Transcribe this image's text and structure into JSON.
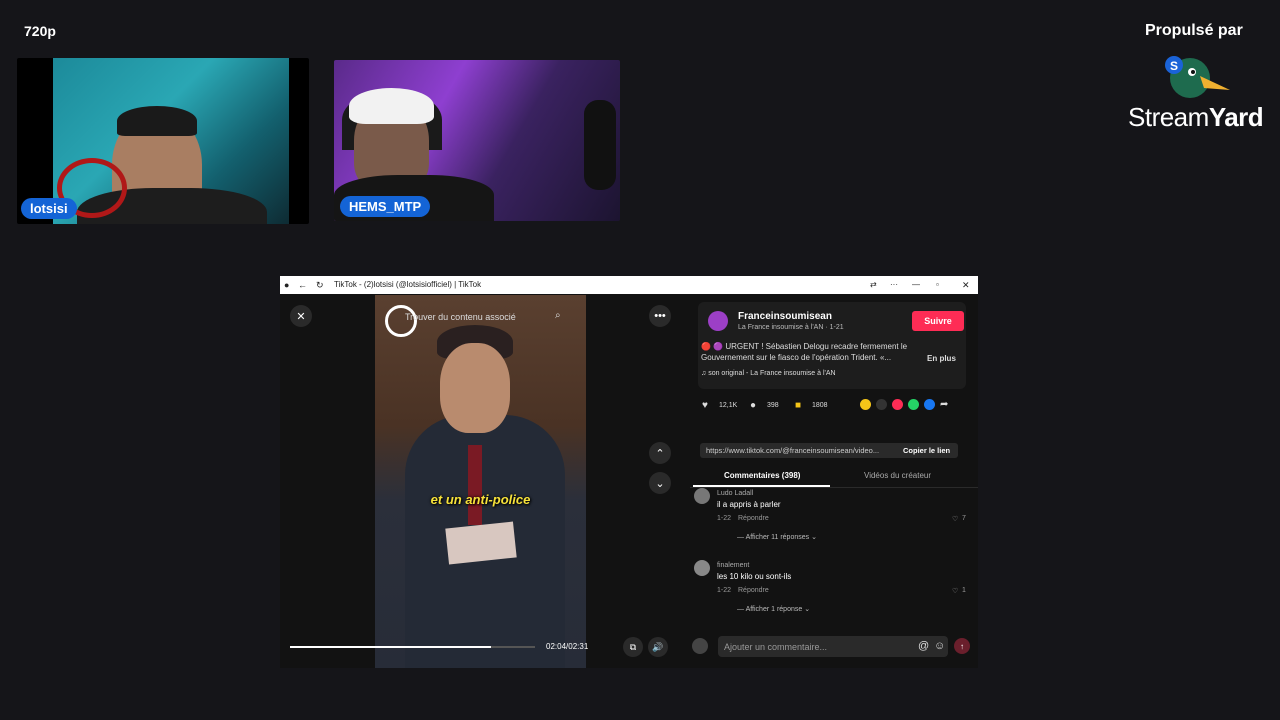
{
  "stream": {
    "quality": "720p",
    "brand_top": "Propulsé par",
    "brand_name_a": "Stream",
    "brand_name_b": "Yard",
    "participants": [
      "lotsisi",
      "HEMS_MTP"
    ]
  },
  "browser": {
    "title": "TikTok - (2)lotsisi (@lotsisiofficiel) | TikTok"
  },
  "video": {
    "overlay_text": "Trouver du contenu associé",
    "subtitle": "et un anti-police",
    "time": "02:04/02:31",
    "progress": 0.82
  },
  "panel": {
    "author": "Franceinsoumisean",
    "author_sub": "La France insoumise à l'AN · 1-21",
    "follow": "Suivre",
    "caption": "🔴 🟣 URGENT ! Sébastien Delogu recadre fermement le Gouvernement sur le fiasco de l'opération Trident. «...",
    "more": "En plus",
    "sound": "♫ son original - La France insoumise à l'AN",
    "likes": "12,1K",
    "comments": "398",
    "saves": "1808",
    "link": "https://www.tiktok.com/@franceinsoumisean/video...",
    "copy_link": "Copier le lien",
    "tab_comments": "Commentaires (398)",
    "tab_videos": "Vidéos du créateur",
    "comment_list": [
      {
        "name": "Ludo Ladall",
        "text": "il a appris à parler",
        "date": "1-22",
        "reply": "Répondre",
        "likes": "7",
        "more": "Afficher 11 réponses"
      },
      {
        "name": "finalement",
        "text": "les 10 kilo ou sont-ils",
        "date": "1-22",
        "reply": "Répondre",
        "likes": "1",
        "more": "Afficher 1 réponse"
      }
    ],
    "comment_placeholder": "Ajouter un commentaire..."
  },
  "colors": {
    "accent": "#fe2c55",
    "tag": "#1464d6",
    "subtitle": "#f7e23a"
  },
  "icons": [
    "close-icon",
    "search-icon",
    "more-icon",
    "chevron-up-icon",
    "chevron-down-icon",
    "volume-icon",
    "heart-icon",
    "comment-icon",
    "bookmark-icon",
    "share-icon",
    "at-icon",
    "emoji-icon",
    "send-icon"
  ]
}
